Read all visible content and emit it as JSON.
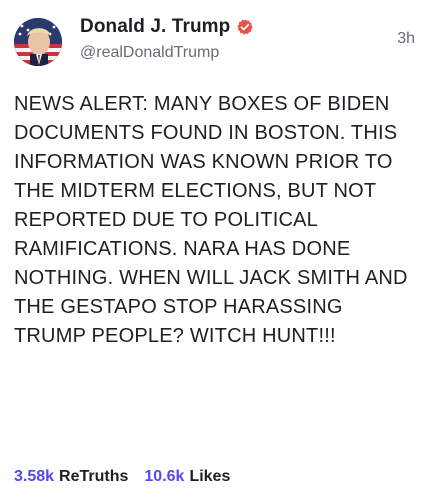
{
  "post": {
    "author": {
      "display_name": "Donald J. Trump",
      "handle": "@realDonaldTrump",
      "verified_icon": "verified-badge-icon",
      "verified_color": "#e8524a"
    },
    "time": "3h",
    "content": "NEWS ALERT: MANY BOXES OF BIDEN DOCUMENTS FOUND IN BOSTON. THIS INFORMATION WAS KNOWN PRIOR TO THE MIDTERM ELECTIONS, BUT NOT REPORTED DUE TO POLITICAL RAMIFICATIONS. NARA HAS DONE NOTHING. WHEN WILL JACK SMITH AND THE GESTAPO STOP HARASSING TRUMP PEOPLE? WITCH HUNT!!!",
    "stats": {
      "retruths_count": "3.58k",
      "retruths_label": "ReTruths",
      "likes_count": "10.6k",
      "likes_label": "Likes"
    }
  },
  "colors": {
    "accent": "#5448ee",
    "text": "#1f1f24",
    "muted": "#6a6a78"
  }
}
